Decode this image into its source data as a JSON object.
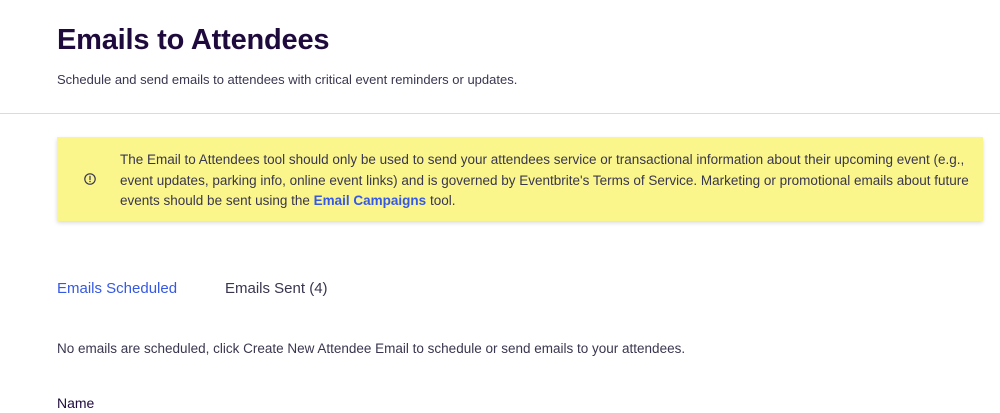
{
  "header": {
    "title": "Emails to Attendees",
    "subtitle": "Schedule and send emails to attendees with critical event reminders or updates."
  },
  "notice": {
    "icon": "info-circle-icon",
    "text_before_link": "The Email to Attendees tool should only be used to send your attendees service or transactional information about their upcoming event (e.g., event updates, parking info, online event links) and is governed by Eventbrite's Terms of Service. Marketing or promotional emails about future events should be sent using the ",
    "link_label": "Email Campaigns",
    "text_after_link": " tool.",
    "background_color": "#fbf68c",
    "link_color": "#3659e3"
  },
  "tabs": [
    {
      "label": "Emails Scheduled",
      "active": true
    },
    {
      "label": "Emails Sent (4)",
      "active": false
    }
  ],
  "empty_state": {
    "message": "No emails are scheduled, click Create New Attendee Email to schedule or send emails to your attendees."
  },
  "table": {
    "columns": [
      "Name"
    ]
  }
}
